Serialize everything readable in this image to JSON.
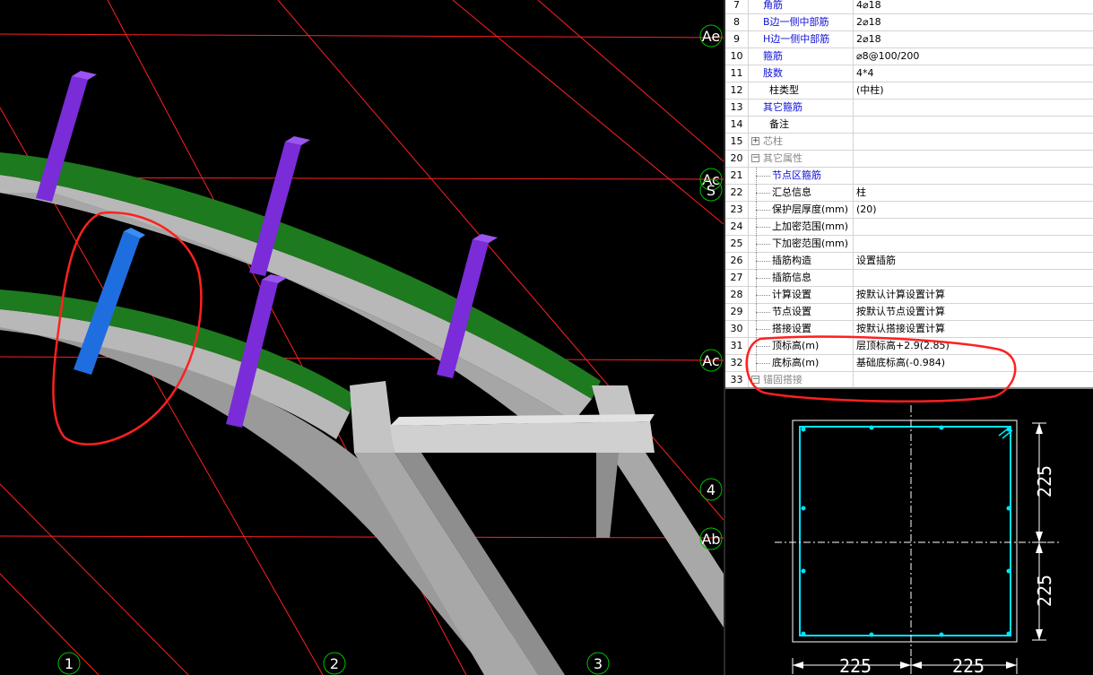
{
  "viewport": {
    "axis_labels": [
      "Ae",
      "Ac",
      "S",
      "Ac",
      "4",
      "Ab",
      "1",
      "2",
      "3"
    ],
    "colors": {
      "background": "#000000",
      "gridline": "#ff2020",
      "beam": "#b8b8b8",
      "ledge": "#1e7a1e",
      "column": "#7a2cd8",
      "selected_column": "#1e6ee0",
      "annotation": "#ff2020",
      "axis_circle": "#00c000"
    }
  },
  "properties": {
    "rows": [
      {
        "num": "7",
        "name": "角筋",
        "value": "4⌀18",
        "style": "blue"
      },
      {
        "num": "8",
        "name": "B边一侧中部筋",
        "value": "2⌀18",
        "style": "blue"
      },
      {
        "num": "9",
        "name": "H边一侧中部筋",
        "value": "2⌀18",
        "style": "blue"
      },
      {
        "num": "10",
        "name": "箍筋",
        "value": "⌀8@100/200",
        "style": "blue"
      },
      {
        "num": "11",
        "name": "肢数",
        "value": "4*4",
        "style": "blue"
      },
      {
        "num": "12",
        "name": "柱类型",
        "value": "(中柱)",
        "style": "normal"
      },
      {
        "num": "13",
        "name": "其它箍筋",
        "value": "",
        "style": "blue"
      },
      {
        "num": "14",
        "name": "备注",
        "value": "",
        "style": "normal"
      },
      {
        "num": "15",
        "name": "芯柱",
        "value": "",
        "style": "gray",
        "expander": "+"
      },
      {
        "num": "20",
        "name": "其它属性",
        "value": "",
        "style": "gray",
        "expander": "−"
      },
      {
        "num": "21",
        "name": "节点区箍筋",
        "value": "",
        "style": "blue",
        "child": true
      },
      {
        "num": "22",
        "name": "汇总信息",
        "value": "柱",
        "style": "normal",
        "child": true
      },
      {
        "num": "23",
        "name": "保护层厚度(mm)",
        "value": "(20)",
        "style": "normal",
        "child": true
      },
      {
        "num": "24",
        "name": "上加密范围(mm)",
        "value": "",
        "style": "normal",
        "child": true
      },
      {
        "num": "25",
        "name": "下加密范围(mm)",
        "value": "",
        "style": "normal",
        "child": true
      },
      {
        "num": "26",
        "name": "插筋构造",
        "value": "设置插筋",
        "style": "normal",
        "child": true
      },
      {
        "num": "27",
        "name": "插筋信息",
        "value": "",
        "style": "normal",
        "child": true
      },
      {
        "num": "28",
        "name": "计算设置",
        "value": "按默认计算设置计算",
        "style": "normal",
        "child": true
      },
      {
        "num": "29",
        "name": "节点设置",
        "value": "按默认节点设置计算",
        "style": "normal",
        "child": true
      },
      {
        "num": "30",
        "name": "搭接设置",
        "value": "按默认搭接设置计算",
        "style": "normal",
        "child": true
      },
      {
        "num": "31",
        "name": "顶标高(m)",
        "value": "层顶标高+2.9(2.85)",
        "style": "normal",
        "child": true
      },
      {
        "num": "32",
        "name": "底标高(m)",
        "value": "基础底标高(-0.984)",
        "style": "normal",
        "child": true
      },
      {
        "num": "33",
        "name": "锚固搭接",
        "value": "",
        "style": "gray",
        "expander": "−"
      }
    ]
  },
  "section": {
    "dim_top": "225",
    "dim_bottom": "225",
    "dim_left": "225",
    "dim_right": "225",
    "colors": {
      "outline": "#ffffff",
      "stirrup": "#00e5ff",
      "centerline": "#ffffff"
    }
  }
}
